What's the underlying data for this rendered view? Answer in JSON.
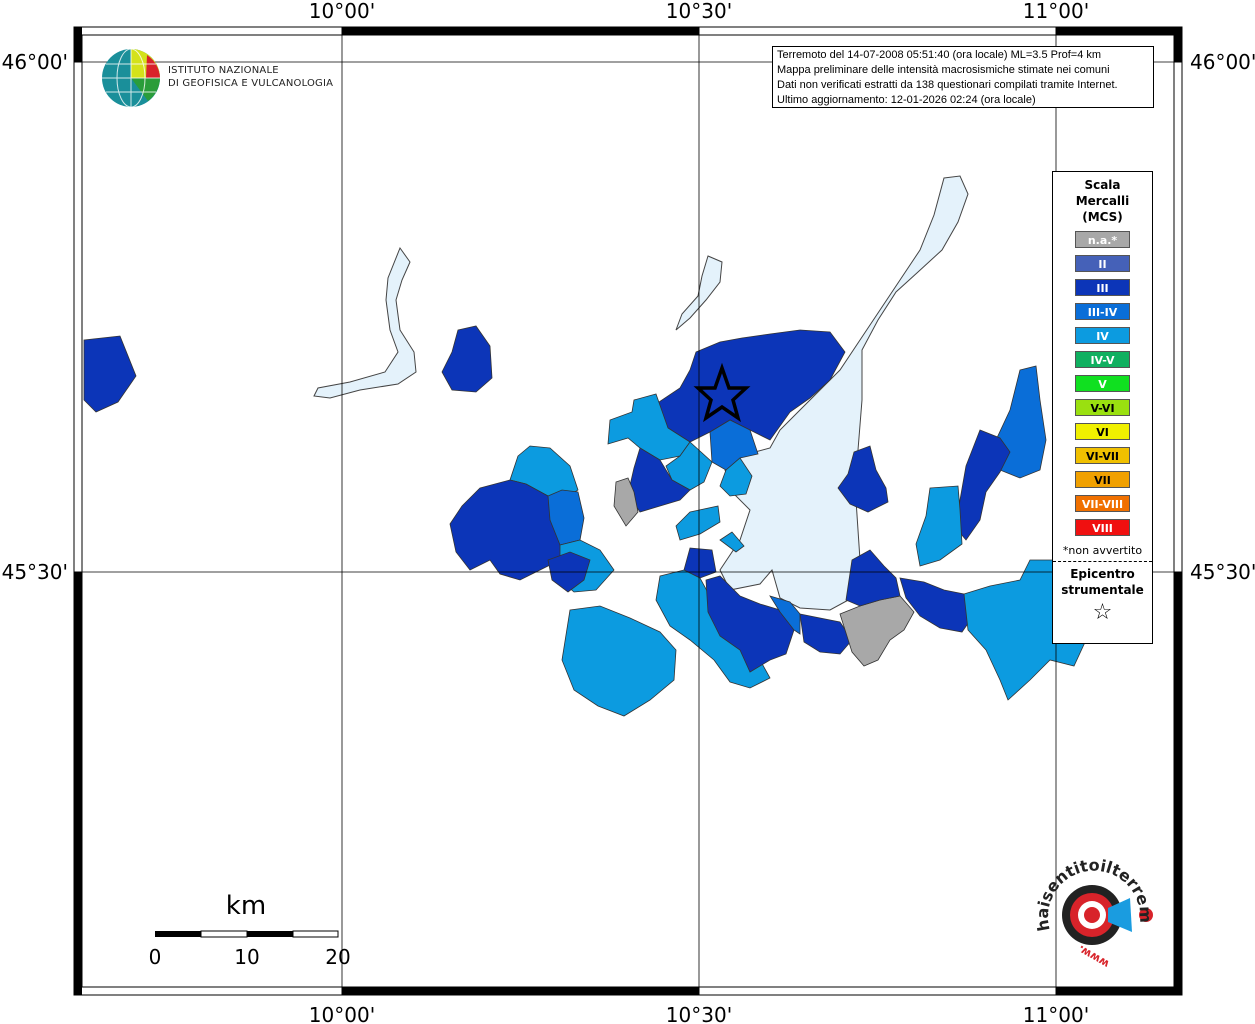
{
  "title_box": {
    "line1": "Terremoto del 14-07-2008 05:51:40 (ora locale) ML=3.5 Prof=4 km",
    "line2": "Mappa preliminare delle intensità macrosismiche stimate nei comuni",
    "line3": "Dati non verificati estratti da 138 questionari compilati tramite Internet.",
    "line4": "Ultimo aggiornamento: 12-01-2026 02:24 (ora locale)"
  },
  "logo": {
    "line1": "ISTITUTO NAZIONALE",
    "line2": "DI GEOFISICA E VULCANOLOGIA"
  },
  "lon_labels": [
    "10°00'",
    "10°30'",
    "11°00'"
  ],
  "lat_labels": [
    "46°00'",
    "45°30'"
  ],
  "legend": {
    "title": "Scala Mercalli (MCS)",
    "classes": [
      {
        "label": "n.a.*",
        "color": "#a8a8a8"
      },
      {
        "label": "II",
        "color": "#4561b8"
      },
      {
        "label": "III",
        "color": "#0c35b8"
      },
      {
        "label": "III-IV",
        "color": "#0a6ed8"
      },
      {
        "label": "IV",
        "color": "#0c9be0"
      },
      {
        "label": "IV-V",
        "color": "#10b060"
      },
      {
        "label": "V",
        "color": "#10e020"
      },
      {
        "label": "V-VI",
        "color": "#9ae010"
      },
      {
        "label": "VI",
        "color": "#f0f000"
      },
      {
        "label": "VI-VII",
        "color": "#f0c000"
      },
      {
        "label": "VII",
        "color": "#f0a000"
      },
      {
        "label": "VII-VIII",
        "color": "#f07000"
      },
      {
        "label": "VIII",
        "color": "#f01010"
      }
    ],
    "note": "*non avvertito",
    "epicenter_label": "Epicentro strumentale",
    "epicenter_symbol": "☆"
  },
  "scale_bar": {
    "unit": "km",
    "ticks": [
      "0",
      "10",
      "20"
    ]
  },
  "watermark": {
    "text": "haisentitoilterremoto.it",
    "url": "www."
  },
  "colors": {
    "lake": "#e4f2fb",
    "intensity_III": "#0c35b8",
    "intensity_III_IV": "#0a6ed8",
    "intensity_IV": "#0c9be0",
    "na": "#a8a8a8"
  }
}
